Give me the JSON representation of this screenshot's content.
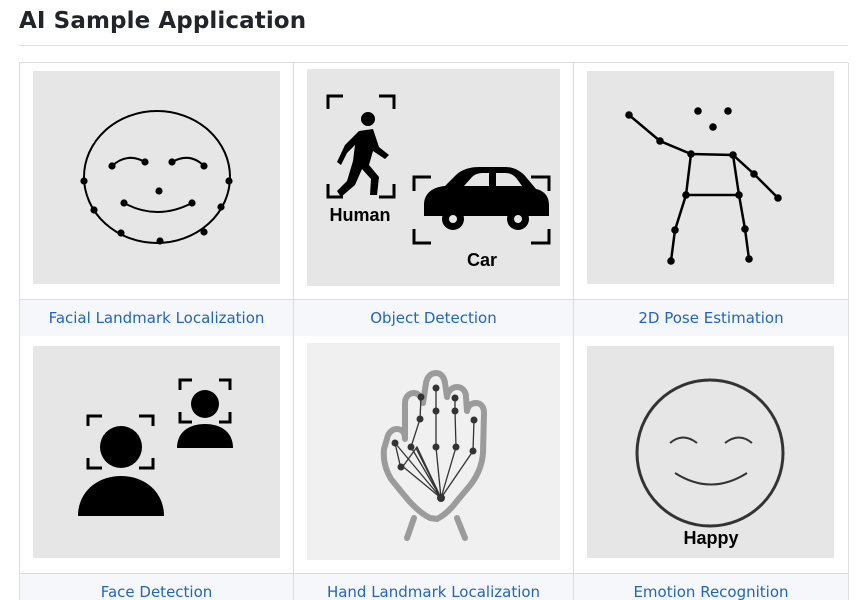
{
  "page": {
    "title": "AI Sample Application"
  },
  "samples": [
    {
      "label": "Facial Landmark Localization"
    },
    {
      "label": "Object Detection",
      "tags": {
        "human": "Human",
        "car": "Car"
      }
    },
    {
      "label": "2D Pose Estimation"
    },
    {
      "label": "Face Detection"
    },
    {
      "label": "Hand Landmark Localization"
    },
    {
      "label": "Emotion Recognition",
      "tags": {
        "emotion": "Happy"
      }
    }
  ],
  "colors": {
    "caption_text": "#1f65c4",
    "caption_bg": "#f5f7fa",
    "thumb_bg": "#e6e6e6"
  }
}
